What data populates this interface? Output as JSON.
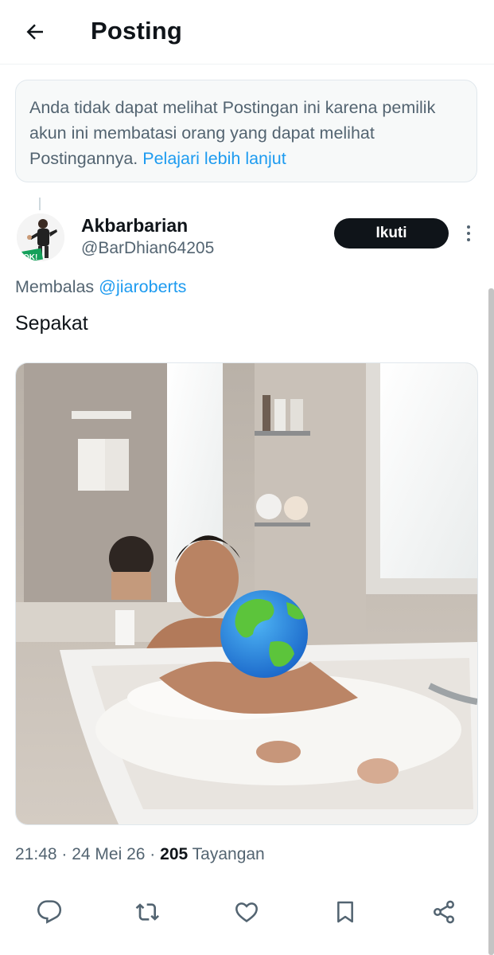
{
  "header": {
    "title": "Posting",
    "back_icon": "arrow-left-icon"
  },
  "notice": {
    "text": "Anda tidak dapat melihat Postingan ini karena pemilik akun ini membatasi orang yang dapat melihat Postingannya.",
    "link": "Pelajari lebih lanjut"
  },
  "author": {
    "name": "Akbarbarian",
    "handle": "@BarDhian64205",
    "avatar_badge": "OK!"
  },
  "follow_label": "Ikuti",
  "reply": {
    "prefix": "Membalas",
    "handle": "@jiaroberts"
  },
  "post": {
    "text": "Sepakat",
    "time": "21:48",
    "date": "24 Mei 26",
    "views_count": "205",
    "views_label": "Tayangan"
  },
  "actions": {
    "reply_icon": "reply-icon",
    "repost_icon": "repost-icon",
    "like_icon": "heart-icon",
    "bookmark_icon": "bookmark-icon",
    "share_icon": "share-icon"
  },
  "colors": {
    "accent": "#1d9bf0",
    "text": "#0f1419",
    "secondary": "#536471",
    "button": "#0f1419"
  }
}
